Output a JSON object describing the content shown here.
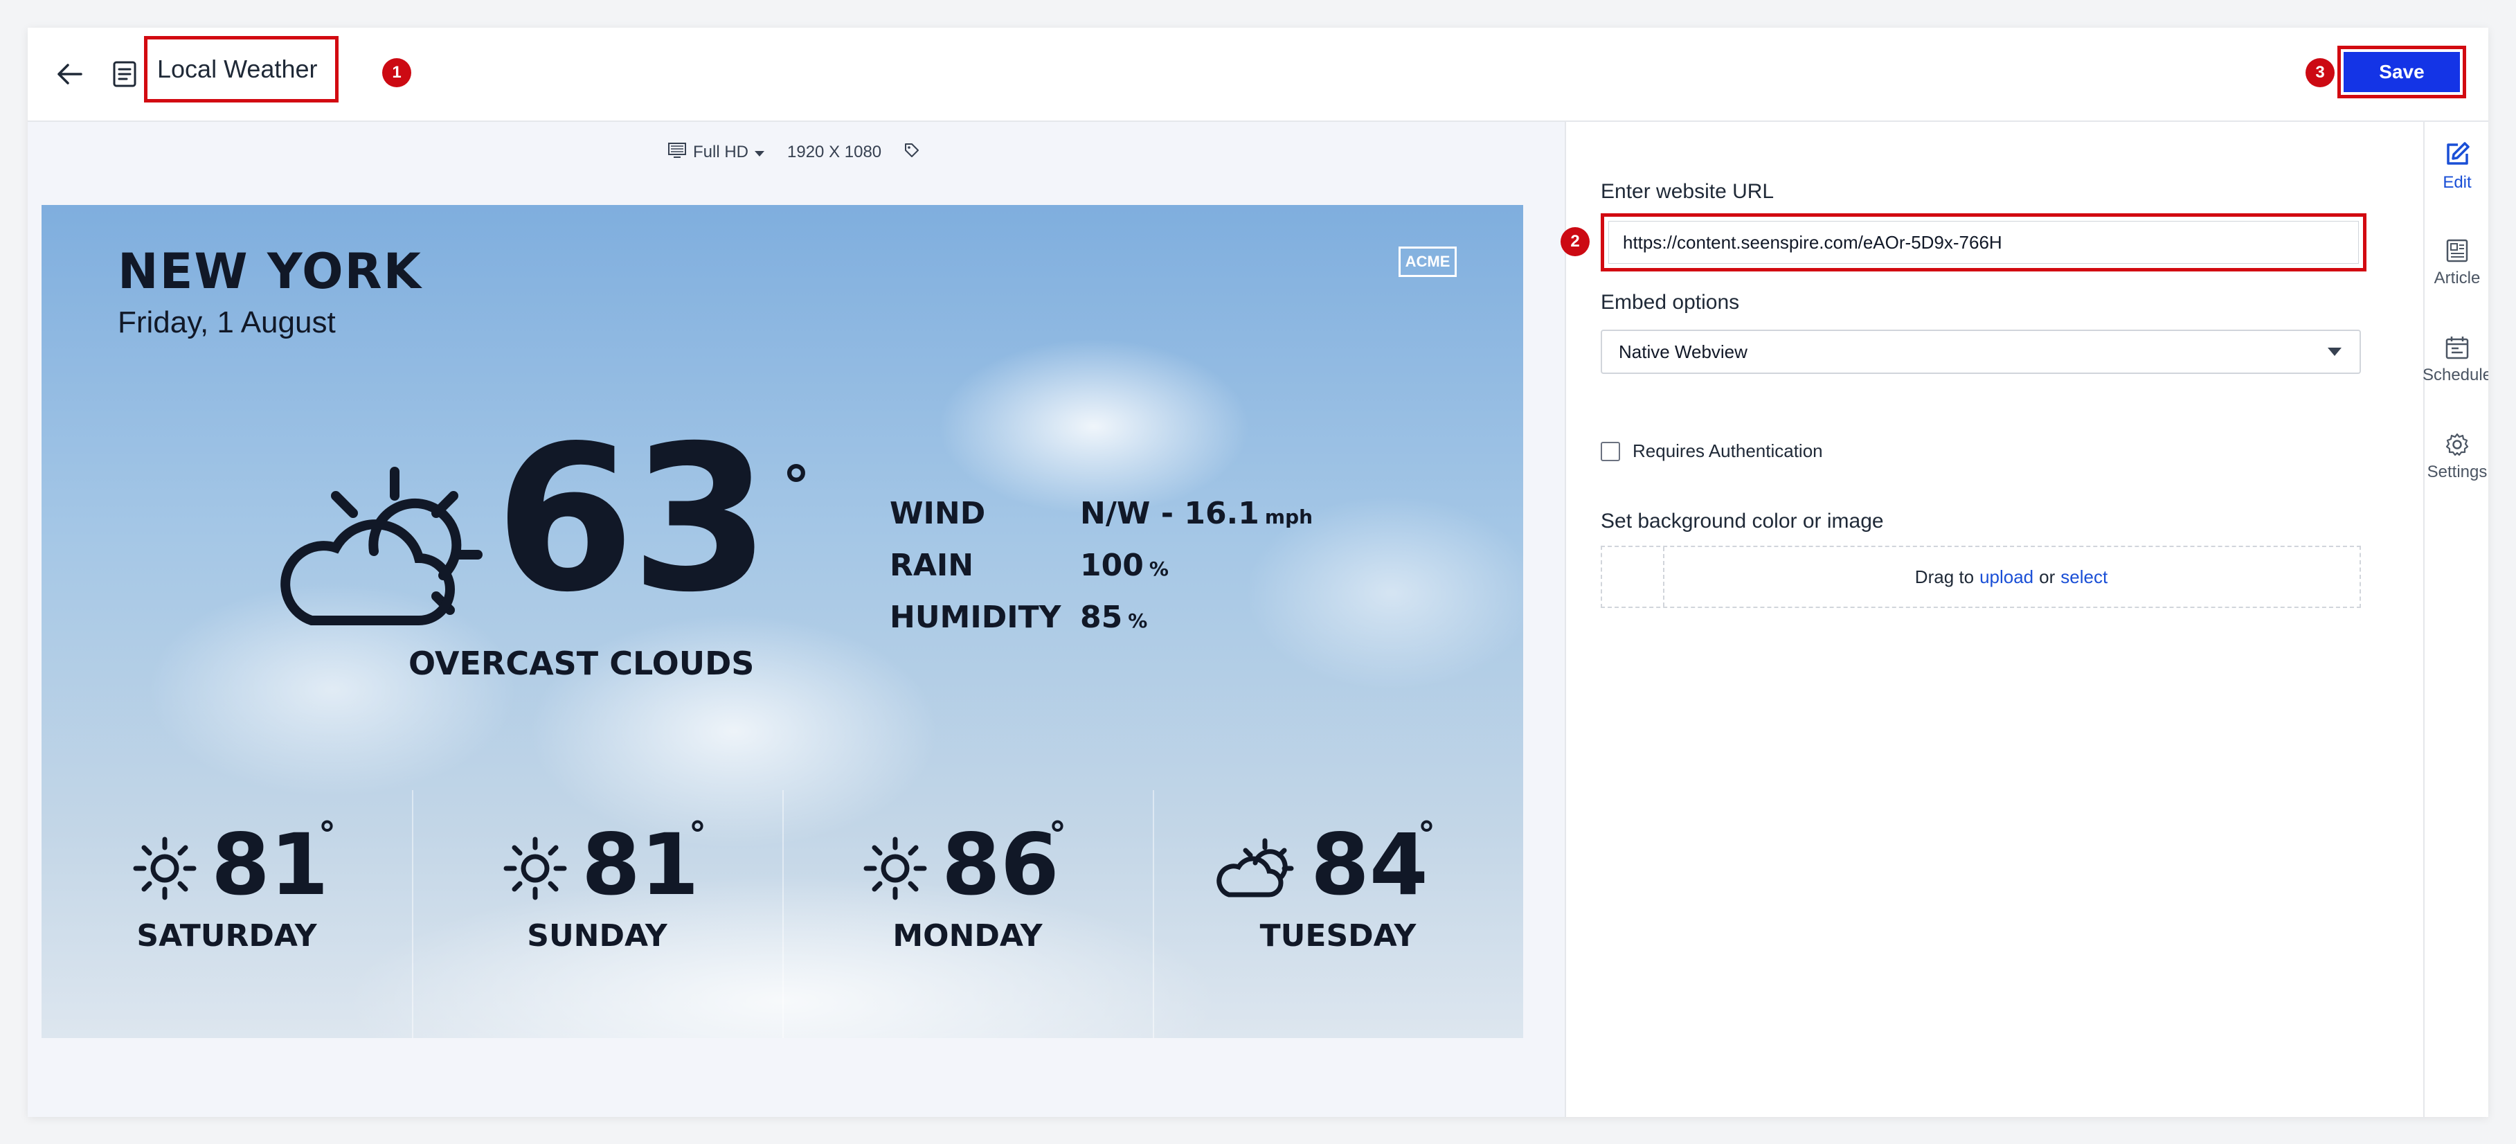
{
  "header": {
    "title": "Local Weather",
    "save_label": "Save",
    "callouts": [
      "1",
      "2",
      "3"
    ]
  },
  "preview_toolbar": {
    "resolution_name": "Full HD",
    "resolution_size": "1920 X 1080"
  },
  "weather": {
    "city": "NEW YORK",
    "date": "Friday, 1 August",
    "brand": "ACME",
    "temperature": "63",
    "degree_symbol": "°",
    "condition": "OVERCAST CLOUDS",
    "stats": [
      {
        "label": "WIND",
        "value": "N/W - 16.1",
        "unit": "mph"
      },
      {
        "label": "RAIN",
        "value": "100",
        "unit": "%"
      },
      {
        "label": "HUMIDITY",
        "value": "85",
        "unit": "%"
      }
    ],
    "forecast": [
      {
        "day": "SATURDAY",
        "temp": "81",
        "icon": "sun-icon"
      },
      {
        "day": "SUNDAY",
        "temp": "81",
        "icon": "sun-icon"
      },
      {
        "day": "MONDAY",
        "temp": "86",
        "icon": "sun-icon"
      },
      {
        "day": "TUESDAY",
        "temp": "84",
        "icon": "partly-cloudy-icon"
      }
    ]
  },
  "form": {
    "url_label": "Enter website URL",
    "url_value": "https://content.seenspire.com/eAOr-5D9x-766H",
    "embed_label": "Embed options",
    "embed_value": "Native Webview",
    "auth_label": "Requires Authentication",
    "bg_label": "Set background color or image",
    "drag_text": "Drag to",
    "upload_link": "upload",
    "or_text": "or",
    "select_link": "select"
  },
  "side_nav": [
    {
      "label": "Edit",
      "icon": "edit-icon",
      "active": true
    },
    {
      "label": "Article",
      "icon": "article-icon",
      "active": false
    },
    {
      "label": "Schedule",
      "icon": "schedule-icon",
      "active": false
    },
    {
      "label": "Settings",
      "icon": "gear-icon",
      "active": false
    }
  ],
  "colors": {
    "accent": "#1434e6",
    "callout_red": "#d20a11",
    "link": "#1a4fd6"
  }
}
